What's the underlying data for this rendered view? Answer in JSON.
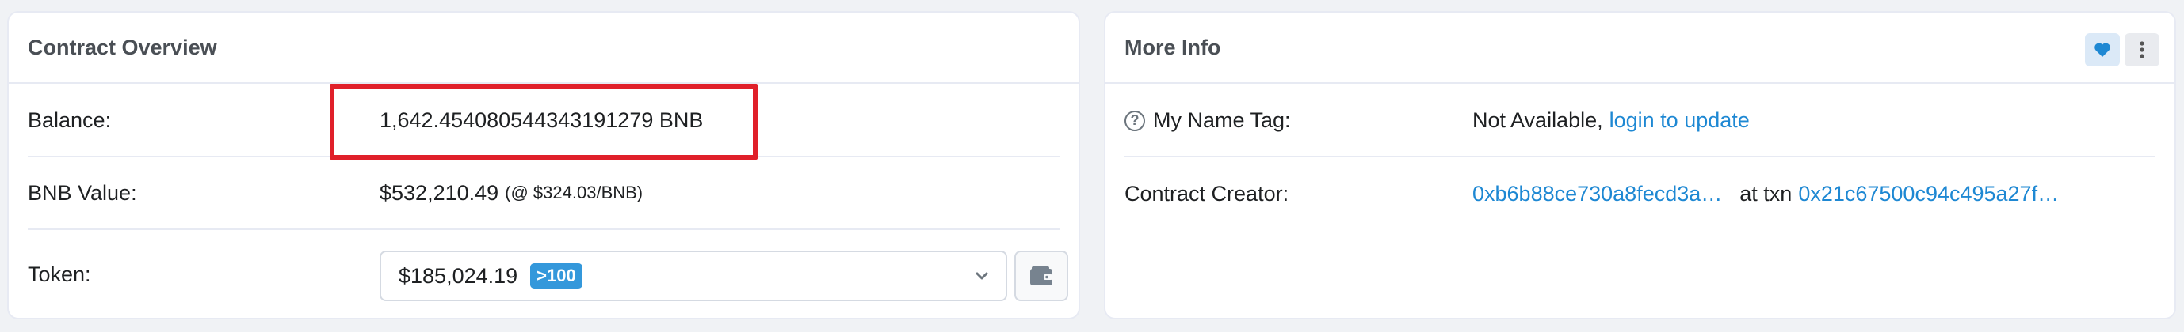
{
  "overview": {
    "title": "Contract Overview",
    "balance_label": "Balance:",
    "balance_value": "1,642.454080544343191279 BNB",
    "bnb_value_label": "BNB Value:",
    "bnb_value": "$532,210.49",
    "bnb_rate": "(@ $324.03/BNB)",
    "token_label": "Token:",
    "token_value": "$185,024.19",
    "token_badge": ">100"
  },
  "more_info": {
    "title": "More Info",
    "name_tag_label": "My Name Tag:",
    "name_tag_value": "Not Available,",
    "name_tag_link": "login to update",
    "creator_label": "Contract Creator:",
    "creator_address": "0xb6b88ce730a8fecd3a…",
    "creator_at_txn": "at txn",
    "creator_txn": "0x21c67500c94c495a27f…"
  },
  "colors": {
    "link": "#1e88d3",
    "highlight": "#e0202a",
    "badge": "#3498db"
  },
  "icons": {
    "heart": "heart-icon",
    "more": "vertical-ellipsis-icon",
    "wallet": "wallet-icon",
    "chevron": "chevron-down-icon",
    "help": "question-circle-icon"
  }
}
